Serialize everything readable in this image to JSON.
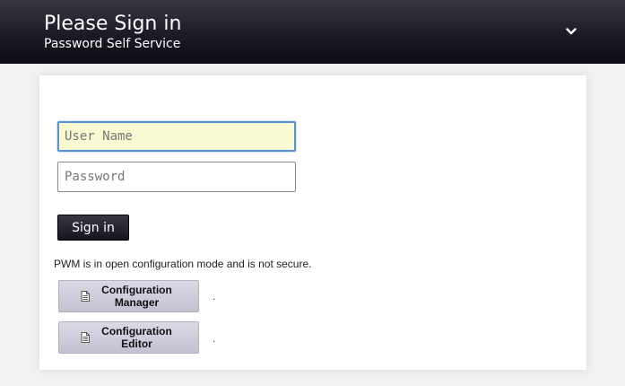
{
  "header": {
    "title": "Please Sign in",
    "subtitle": "Password Self Service",
    "menu_icon": "chevron-down-icon"
  },
  "form": {
    "username": {
      "value": "",
      "placeholder": "User Name"
    },
    "password": {
      "value": "",
      "placeholder": "Password"
    },
    "signin_label": "Sign in"
  },
  "config": {
    "notice": "PWM is in open configuration mode and is not secure.",
    "buttons": [
      {
        "label": "Configuration Manager",
        "icon": "document-icon",
        "trailing_text": "."
      },
      {
        "label": "Configuration Editor",
        "icon": "document-icon",
        "trailing_text": "."
      }
    ]
  },
  "colors": {
    "header_bg": "#1c1a24",
    "field_focus_bg": "#fafad2",
    "field_focus_border": "#5a8fd6",
    "config_button_bg": "#d0ccdc"
  }
}
